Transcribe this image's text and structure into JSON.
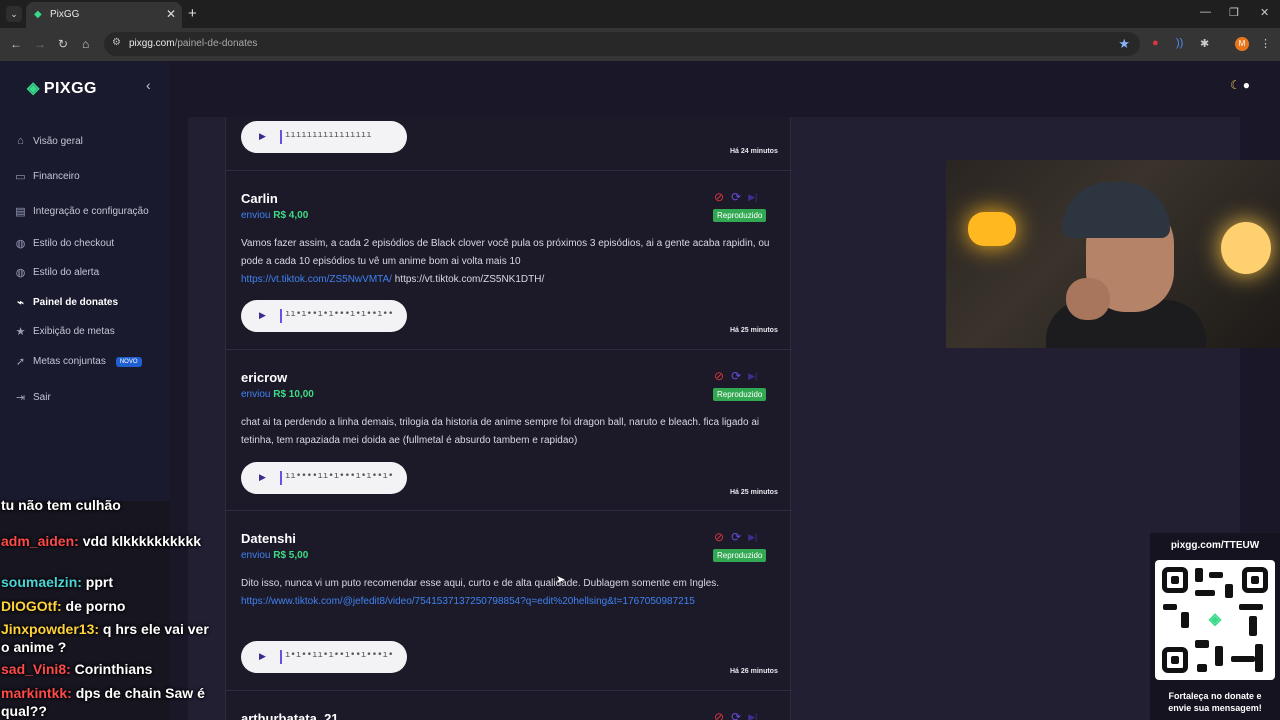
{
  "browser": {
    "tab_title": "PixGG",
    "url_host": "pixgg.com",
    "url_path": "/painel-de-donates",
    "profile_initial": "M"
  },
  "sidebar": {
    "brand": "PIXGG",
    "items": [
      {
        "label": "Visão geral",
        "icon": "home-icon"
      },
      {
        "label": "Financeiro",
        "icon": "wallet-icon"
      },
      {
        "label": "Integração e configuração",
        "icon": "settings-icon"
      },
      {
        "label": "Estilo do checkout",
        "icon": "palette-icon"
      },
      {
        "label": "Estilo do alerta",
        "icon": "palette-icon"
      },
      {
        "label": "Painel de donates",
        "icon": "broom-icon"
      },
      {
        "label": "Exibição de metas",
        "icon": "star-icon"
      },
      {
        "label": "Metas conjuntas",
        "icon": "rocket-icon",
        "badge": "NOVO"
      },
      {
        "label": "Sair",
        "icon": "logout-icon"
      }
    ]
  },
  "donations": [
    {
      "name": "",
      "prefix": "",
      "amount": "",
      "status": "",
      "message": "",
      "link": "",
      "link2": "",
      "time": "Há 24 minutos"
    },
    {
      "name": "Carlin",
      "prefix": "enviou",
      "amount": "R$ 4,00",
      "status": "Reproduzido",
      "message": "Vamos fazer assim, a cada 2 episódios de Black clover você pula os próximos 3 episódios, ai a gente acaba rapidin, ou pode a cada 10 episódios tu vê um anime bom ai volta mais 10",
      "link": "https://vt.tiktok.com/ZS5NwVMTA/",
      "link2": "https://vt.tiktok.com/ZS5NK1DTH/",
      "time": "Há 25 minutos"
    },
    {
      "name": "ericrow",
      "prefix": "enviou",
      "amount": "R$ 10,00",
      "status": "Reproduzido",
      "message": "chat ai ta perdendo a linha demais, trilogia da historia de anime sempre foi dragon ball, naruto e bleach. fica ligado ai tetinha, tem rapaziada mei doida ae (fullmetal é absurdo tambem e rapidao)",
      "link": "",
      "link2": "",
      "time": "Há 25 minutos"
    },
    {
      "name": "Datenshi",
      "prefix": "enviou",
      "amount": "R$ 5,00",
      "status": "Reproduzido",
      "message": "Dito isso, nunca vi um puto recomendar esse aqui, curto e de alta qualidade. Dublagem somente em Ingles.",
      "link": "https://www.tiktok.com/@jefedit8/video/7541537137250798854?q=edit%20hellsing&t=1767050987215",
      "link2": "",
      "time": "Há 26 minutos"
    },
    {
      "name": "arthurbatata_21",
      "prefix": "",
      "amount": "",
      "status": "",
      "message": "",
      "link": "",
      "link2": "",
      "time": ""
    }
  ],
  "chat": [
    {
      "user": "",
      "text": "tu não tem culhão"
    },
    {
      "user": "adm_aiden:",
      "text": "vdd klkkkkkkkkkk"
    },
    {
      "user": "soumaelzin:",
      "text": "pprt"
    },
    {
      "user": "DIOGOtf:",
      "text": "de porno"
    },
    {
      "user": "Jinxpowder13:",
      "text": "q hrs ele vai ver o anime ?"
    },
    {
      "user": "sad_Vini8:",
      "text": "Corinthians"
    },
    {
      "user": "markintkk:",
      "text": "dps de chain Saw é qual??"
    }
  ],
  "qr_overlay": {
    "url": "pixgg.com/TTEUW",
    "footer_line1": "Fortaleça no donate e",
    "footer_line2": "envie sua mensagem!"
  },
  "colors": {
    "brand_green": "#39d98a",
    "status_green": "#32a852",
    "amount_green": "#3ddc84",
    "link_blue": "#3f82f0",
    "block_red": "#e0343e"
  }
}
